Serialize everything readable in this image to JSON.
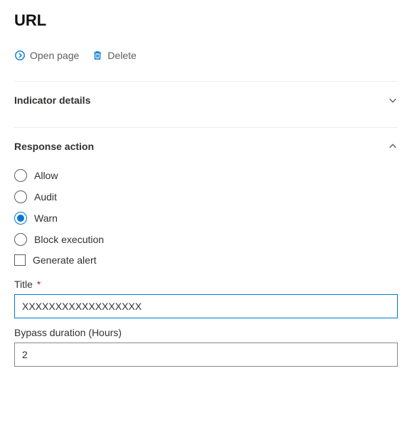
{
  "header": {
    "title": "URL"
  },
  "actions": {
    "open_page": "Open page",
    "delete": "Delete"
  },
  "sections": {
    "indicator_details": {
      "title": "Indicator details",
      "expanded": false
    },
    "response_action": {
      "title": "Response action",
      "expanded": true,
      "options": {
        "allow": "Allow",
        "audit": "Audit",
        "warn": "Warn",
        "block": "Block execution"
      },
      "selected": "warn",
      "generate_alert": {
        "label": "Generate alert",
        "checked": false
      },
      "title_field": {
        "label": "Title",
        "required": "*",
        "value": "XXXXXXXXXXXXXXXXXX"
      },
      "bypass_field": {
        "label": "Bypass duration (Hours)",
        "value": "2"
      }
    }
  }
}
